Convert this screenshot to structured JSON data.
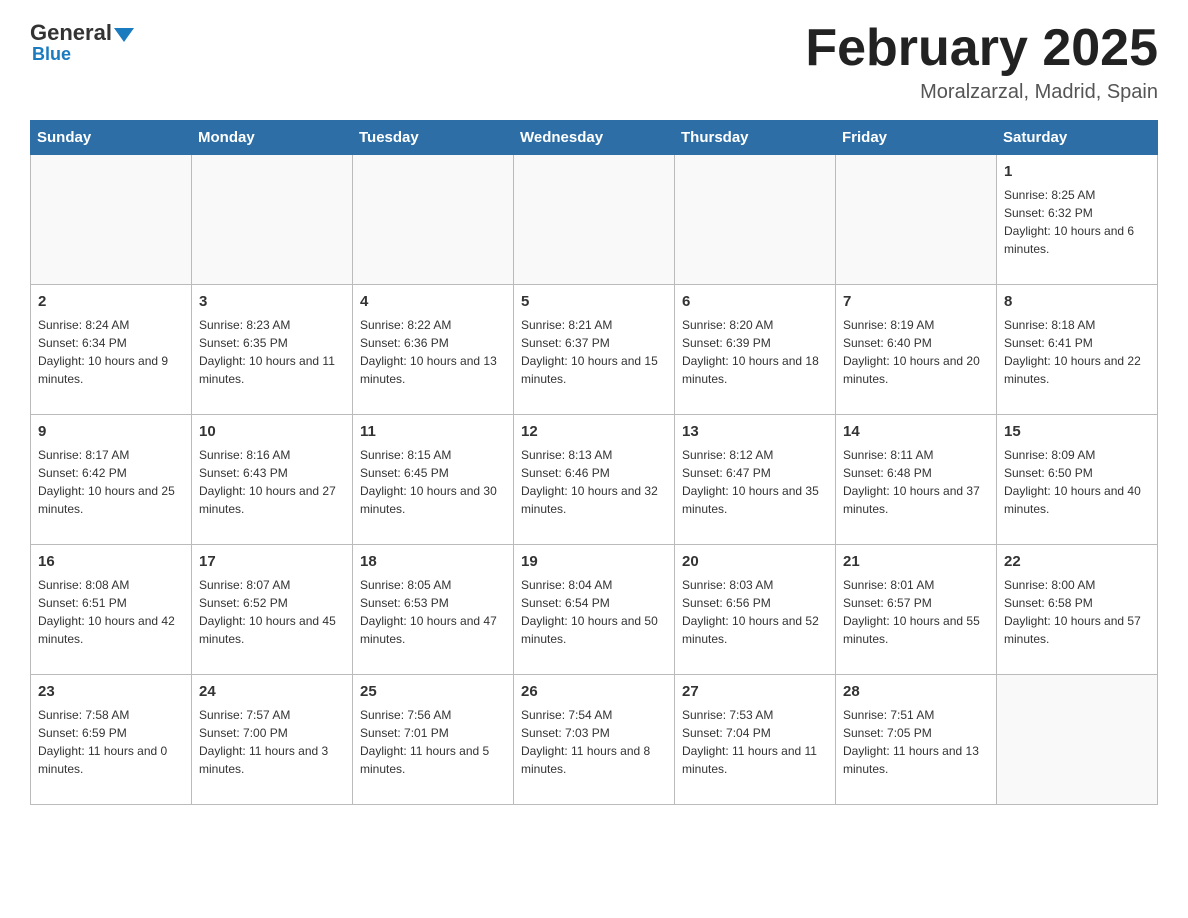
{
  "logo": {
    "general": "General",
    "blue": "Blue"
  },
  "header": {
    "month": "February 2025",
    "location": "Moralzarzal, Madrid, Spain"
  },
  "days_of_week": [
    "Sunday",
    "Monday",
    "Tuesday",
    "Wednesday",
    "Thursday",
    "Friday",
    "Saturday"
  ],
  "weeks": [
    [
      {
        "day": "",
        "sunrise": "",
        "sunset": "",
        "daylight": "",
        "empty": true
      },
      {
        "day": "",
        "sunrise": "",
        "sunset": "",
        "daylight": "",
        "empty": true
      },
      {
        "day": "",
        "sunrise": "",
        "sunset": "",
        "daylight": "",
        "empty": true
      },
      {
        "day": "",
        "sunrise": "",
        "sunset": "",
        "daylight": "",
        "empty": true
      },
      {
        "day": "",
        "sunrise": "",
        "sunset": "",
        "daylight": "",
        "empty": true
      },
      {
        "day": "",
        "sunrise": "",
        "sunset": "",
        "daylight": "",
        "empty": true
      },
      {
        "day": "1",
        "sunrise": "Sunrise: 8:25 AM",
        "sunset": "Sunset: 6:32 PM",
        "daylight": "Daylight: 10 hours and 6 minutes.",
        "empty": false
      }
    ],
    [
      {
        "day": "2",
        "sunrise": "Sunrise: 8:24 AM",
        "sunset": "Sunset: 6:34 PM",
        "daylight": "Daylight: 10 hours and 9 minutes.",
        "empty": false
      },
      {
        "day": "3",
        "sunrise": "Sunrise: 8:23 AM",
        "sunset": "Sunset: 6:35 PM",
        "daylight": "Daylight: 10 hours and 11 minutes.",
        "empty": false
      },
      {
        "day": "4",
        "sunrise": "Sunrise: 8:22 AM",
        "sunset": "Sunset: 6:36 PM",
        "daylight": "Daylight: 10 hours and 13 minutes.",
        "empty": false
      },
      {
        "day": "5",
        "sunrise": "Sunrise: 8:21 AM",
        "sunset": "Sunset: 6:37 PM",
        "daylight": "Daylight: 10 hours and 15 minutes.",
        "empty": false
      },
      {
        "day": "6",
        "sunrise": "Sunrise: 8:20 AM",
        "sunset": "Sunset: 6:39 PM",
        "daylight": "Daylight: 10 hours and 18 minutes.",
        "empty": false
      },
      {
        "day": "7",
        "sunrise": "Sunrise: 8:19 AM",
        "sunset": "Sunset: 6:40 PM",
        "daylight": "Daylight: 10 hours and 20 minutes.",
        "empty": false
      },
      {
        "day": "8",
        "sunrise": "Sunrise: 8:18 AM",
        "sunset": "Sunset: 6:41 PM",
        "daylight": "Daylight: 10 hours and 22 minutes.",
        "empty": false
      }
    ],
    [
      {
        "day": "9",
        "sunrise": "Sunrise: 8:17 AM",
        "sunset": "Sunset: 6:42 PM",
        "daylight": "Daylight: 10 hours and 25 minutes.",
        "empty": false
      },
      {
        "day": "10",
        "sunrise": "Sunrise: 8:16 AM",
        "sunset": "Sunset: 6:43 PM",
        "daylight": "Daylight: 10 hours and 27 minutes.",
        "empty": false
      },
      {
        "day": "11",
        "sunrise": "Sunrise: 8:15 AM",
        "sunset": "Sunset: 6:45 PM",
        "daylight": "Daylight: 10 hours and 30 minutes.",
        "empty": false
      },
      {
        "day": "12",
        "sunrise": "Sunrise: 8:13 AM",
        "sunset": "Sunset: 6:46 PM",
        "daylight": "Daylight: 10 hours and 32 minutes.",
        "empty": false
      },
      {
        "day": "13",
        "sunrise": "Sunrise: 8:12 AM",
        "sunset": "Sunset: 6:47 PM",
        "daylight": "Daylight: 10 hours and 35 minutes.",
        "empty": false
      },
      {
        "day": "14",
        "sunrise": "Sunrise: 8:11 AM",
        "sunset": "Sunset: 6:48 PM",
        "daylight": "Daylight: 10 hours and 37 minutes.",
        "empty": false
      },
      {
        "day": "15",
        "sunrise": "Sunrise: 8:09 AM",
        "sunset": "Sunset: 6:50 PM",
        "daylight": "Daylight: 10 hours and 40 minutes.",
        "empty": false
      }
    ],
    [
      {
        "day": "16",
        "sunrise": "Sunrise: 8:08 AM",
        "sunset": "Sunset: 6:51 PM",
        "daylight": "Daylight: 10 hours and 42 minutes.",
        "empty": false
      },
      {
        "day": "17",
        "sunrise": "Sunrise: 8:07 AM",
        "sunset": "Sunset: 6:52 PM",
        "daylight": "Daylight: 10 hours and 45 minutes.",
        "empty": false
      },
      {
        "day": "18",
        "sunrise": "Sunrise: 8:05 AM",
        "sunset": "Sunset: 6:53 PM",
        "daylight": "Daylight: 10 hours and 47 minutes.",
        "empty": false
      },
      {
        "day": "19",
        "sunrise": "Sunrise: 8:04 AM",
        "sunset": "Sunset: 6:54 PM",
        "daylight": "Daylight: 10 hours and 50 minutes.",
        "empty": false
      },
      {
        "day": "20",
        "sunrise": "Sunrise: 8:03 AM",
        "sunset": "Sunset: 6:56 PM",
        "daylight": "Daylight: 10 hours and 52 minutes.",
        "empty": false
      },
      {
        "day": "21",
        "sunrise": "Sunrise: 8:01 AM",
        "sunset": "Sunset: 6:57 PM",
        "daylight": "Daylight: 10 hours and 55 minutes.",
        "empty": false
      },
      {
        "day": "22",
        "sunrise": "Sunrise: 8:00 AM",
        "sunset": "Sunset: 6:58 PM",
        "daylight": "Daylight: 10 hours and 57 minutes.",
        "empty": false
      }
    ],
    [
      {
        "day": "23",
        "sunrise": "Sunrise: 7:58 AM",
        "sunset": "Sunset: 6:59 PM",
        "daylight": "Daylight: 11 hours and 0 minutes.",
        "empty": false
      },
      {
        "day": "24",
        "sunrise": "Sunrise: 7:57 AM",
        "sunset": "Sunset: 7:00 PM",
        "daylight": "Daylight: 11 hours and 3 minutes.",
        "empty": false
      },
      {
        "day": "25",
        "sunrise": "Sunrise: 7:56 AM",
        "sunset": "Sunset: 7:01 PM",
        "daylight": "Daylight: 11 hours and 5 minutes.",
        "empty": false
      },
      {
        "day": "26",
        "sunrise": "Sunrise: 7:54 AM",
        "sunset": "Sunset: 7:03 PM",
        "daylight": "Daylight: 11 hours and 8 minutes.",
        "empty": false
      },
      {
        "day": "27",
        "sunrise": "Sunrise: 7:53 AM",
        "sunset": "Sunset: 7:04 PM",
        "daylight": "Daylight: 11 hours and 11 minutes.",
        "empty": false
      },
      {
        "day": "28",
        "sunrise": "Sunrise: 7:51 AM",
        "sunset": "Sunset: 7:05 PM",
        "daylight": "Daylight: 11 hours and 13 minutes.",
        "empty": false
      },
      {
        "day": "",
        "sunrise": "",
        "sunset": "",
        "daylight": "",
        "empty": true
      }
    ]
  ]
}
